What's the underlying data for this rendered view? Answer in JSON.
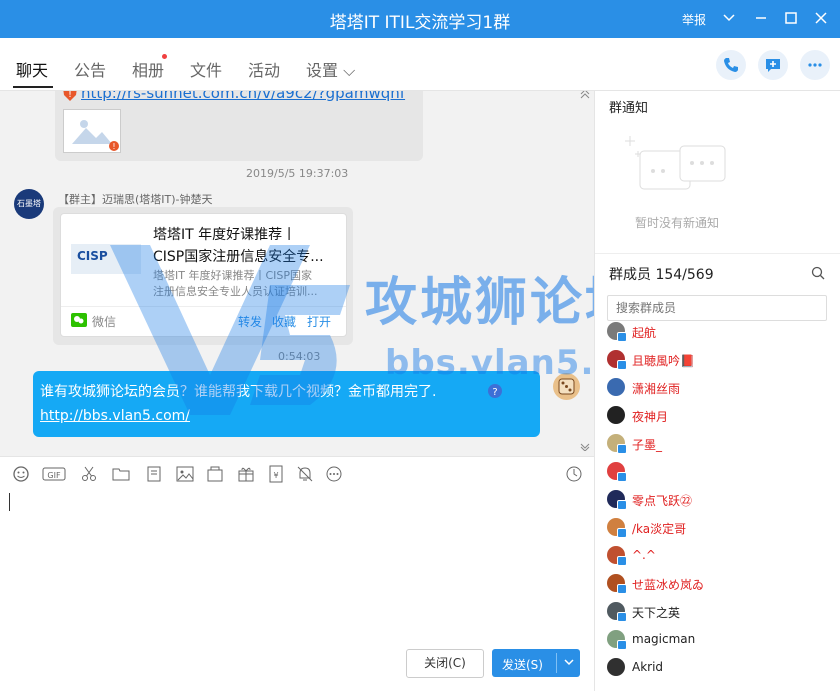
{
  "window": {
    "title": "塔塔IT  ITIL交流学习1群",
    "report_label": "举报"
  },
  "tabs": [
    {
      "label": "聊天",
      "active": true
    },
    {
      "label": "公告"
    },
    {
      "label": "相册",
      "has_dot": true
    },
    {
      "label": "文件"
    },
    {
      "label": "活动"
    },
    {
      "label": "设置 ⌵"
    }
  ],
  "chat": {
    "msg1_link": "http://rs-sunnet.com.cn/v/a9c2/?gpamwqnf",
    "time1": "2019/5/5 19:37:03",
    "msg2_sender": "【群主】迈瑞思(塔塔IT)-钟楚天",
    "avatar_text": "石墨塔",
    "card": {
      "title_line1": "塔塔IT 年度好课推荐丨",
      "title_line2": "CISP国家注册信息安全专...",
      "desc_line1": "塔塔IT 年度好课推荐丨CISP国家",
      "desc_line2": "注册信息安全专业人员认证培训...",
      "thumb_text": "CISP",
      "source": "微信",
      "actions": [
        "转发",
        "收藏",
        "打开"
      ]
    },
    "time2": "0:54:03",
    "msg3_text": "谁有攻城狮论坛的会员？谁能帮我下载几个视频？金币都用完了.",
    "msg3_link": "http://bbs.vlan5.com/",
    "watermark_text": "攻城狮论坛",
    "watermark_url": "bbs.vlan5.com"
  },
  "compose": {
    "close_label": "关闭(C)",
    "send_label": "发送(S)"
  },
  "sidebar": {
    "notice_title": "群通知",
    "notice_empty": "暂时没有新通知",
    "members_title": "群成员 154/569",
    "search_placeholder": "搜索群成员",
    "members": [
      {
        "name": "起航",
        "color": "#e02020",
        "avatar": "#7a7a7a",
        "badge": "#2a8fe6"
      },
      {
        "name": "且聴風吟📕",
        "color": "#e02020",
        "avatar": "#b03030",
        "badge": "#2a8fe6"
      },
      {
        "name": "潇湘丝雨",
        "color": "#e02020",
        "avatar": "#3a6ab0",
        "badge": ""
      },
      {
        "name": "夜神月",
        "color": "#e02020",
        "avatar": "#222222",
        "badge": ""
      },
      {
        "name": "子墨_",
        "color": "#e02020",
        "avatar": "#c4b07a",
        "badge": "#2a8fe6"
      },
      {
        "name": "",
        "color": "#e02020",
        "avatar": "#e04040",
        "badge": "#2a8fe6"
      },
      {
        "name": "零点飞跃㉒",
        "color": "#e02020",
        "avatar": "#202a5a",
        "badge": "#2a8fe6"
      },
      {
        "name": "/ka淡定哥",
        "color": "#e02020",
        "avatar": "#d08040",
        "badge": "#2a8fe6"
      },
      {
        "name": "^.^",
        "color": "#e02020",
        "avatar": "#c05030",
        "badge": "#2a8fe6"
      },
      {
        "name": "せ蓝冰め岚ゐ",
        "color": "#e02020",
        "avatar": "#b05020",
        "badge": "#2a8fe6"
      },
      {
        "name": "天下之英",
        "color": "#222222",
        "avatar": "#505a60",
        "badge": "#2a8fe6"
      },
      {
        "name": "magicman",
        "color": "#222222",
        "avatar": "#80a080",
        "badge": "#2a8fe6"
      },
      {
        "name": "Akrid",
        "color": "#222222",
        "avatar": "#303030",
        "badge": ""
      }
    ]
  }
}
